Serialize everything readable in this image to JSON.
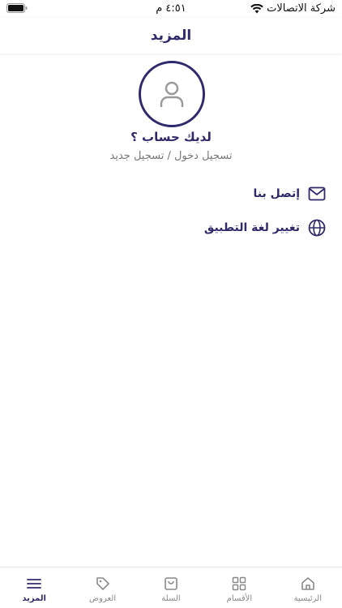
{
  "status_bar": {
    "carrier": "شركة الاتصالات",
    "time": "٤:٥١ م"
  },
  "header": {
    "title": "المزيد"
  },
  "account": {
    "question": "لديك حساب ؟",
    "action": "تسجيل دخول / تسجيل جديد",
    "avatar_icon": "user-icon"
  },
  "menu": {
    "items": [
      {
        "label": "إتصل بنا",
        "icon": "mail-icon"
      },
      {
        "label": "تغيير لغة التطبيق",
        "icon": "globe-icon"
      }
    ]
  },
  "tab_bar": {
    "items": [
      {
        "label": "الرئيسية",
        "icon": "home-icon",
        "active": false
      },
      {
        "label": "الأقسام",
        "icon": "grid-icon",
        "active": false
      },
      {
        "label": "السلة",
        "icon": "bag-icon",
        "active": false
      },
      {
        "label": "العروض",
        "icon": "tag-icon",
        "active": false
      },
      {
        "label": "المزيد",
        "icon": "menu-icon",
        "active": true
      }
    ]
  },
  "colors": {
    "primary": "#2f2a6b",
    "muted": "#8a8a8a"
  }
}
